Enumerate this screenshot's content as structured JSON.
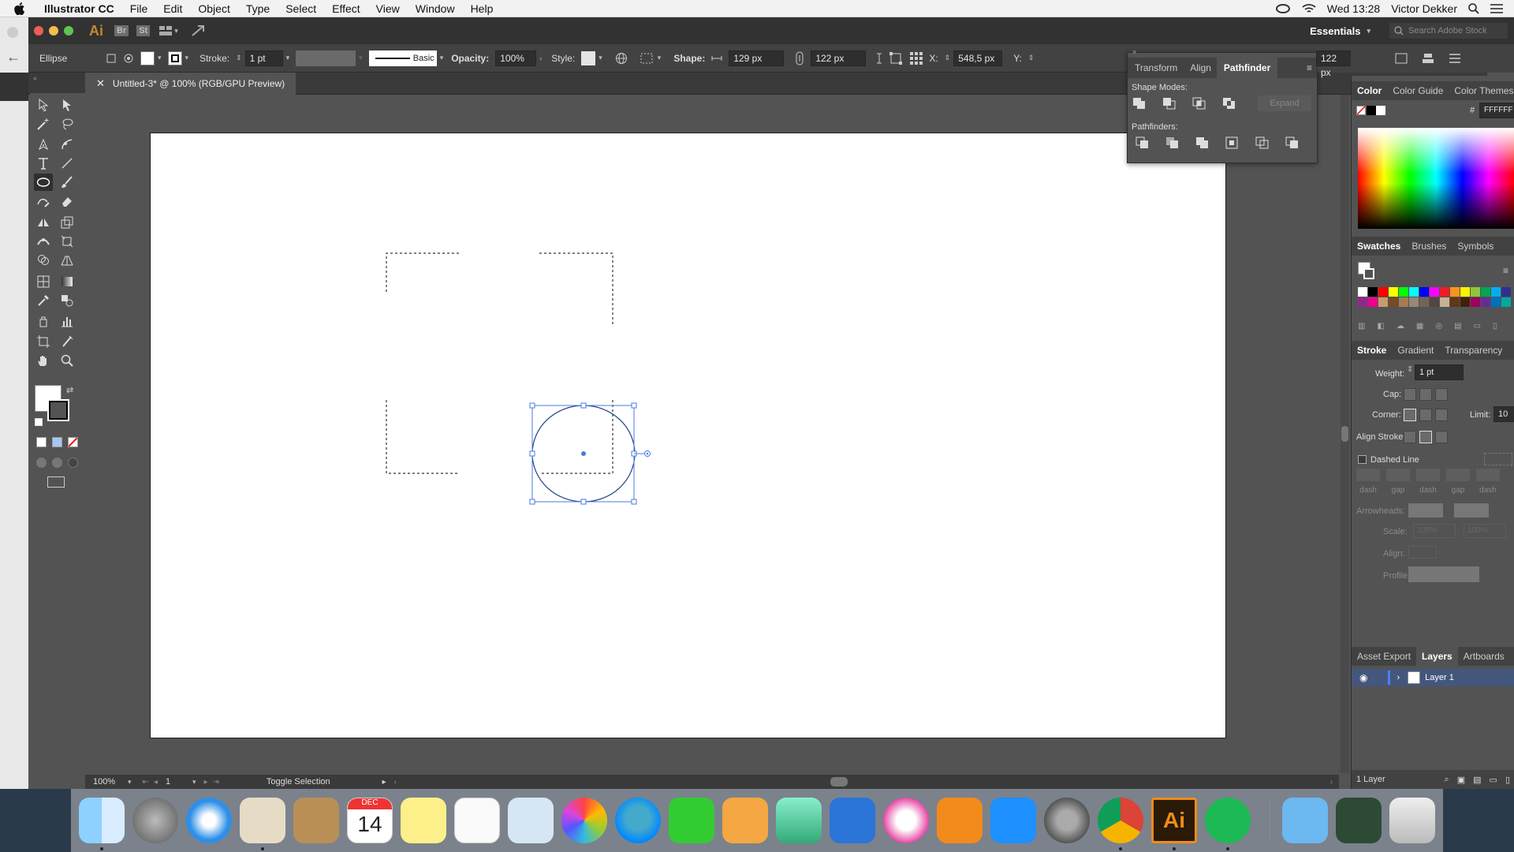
{
  "menubar": {
    "app_name": "Illustrator CC",
    "items": [
      "File",
      "Edit",
      "Object",
      "Type",
      "Select",
      "Effect",
      "View",
      "Window",
      "Help"
    ],
    "clock": "Wed 13:28",
    "user": "Victor Dekker"
  },
  "titlebar": {
    "app_logo": "Ai",
    "bridge": "Br",
    "stock": "St",
    "workspace": "Essentials",
    "search_placeholder": "Search Adobe Stock"
  },
  "control_bar": {
    "object_type": "Ellipse",
    "stroke_label": "Stroke:",
    "stroke_value": "1 pt",
    "brush_name": "Basic",
    "opacity_label": "Opacity:",
    "opacity_value": "100%",
    "style_label": "Style:",
    "shape_label": "Shape:",
    "shape_width": "129 px",
    "height_value": "122 px",
    "x_label": "X:",
    "x_value": "548,5 px",
    "y_label": "Y:",
    "h_value_right": "122 px"
  },
  "document": {
    "tab_title": "Untitled-3* @ 100% (RGB/GPU Preview)"
  },
  "status_bar": {
    "zoom": "100%",
    "artboard_num": "1",
    "status_text": "Toggle Selection"
  },
  "pathfinder_panel": {
    "tabs": [
      "Transform",
      "Align",
      "Pathfinder"
    ],
    "active_tab": "Pathfinder",
    "shape_modes_label": "Shape Modes:",
    "expand_label": "Expand",
    "pathfinders_label": "Pathfinders:"
  },
  "color_panel": {
    "tabs": [
      "Color",
      "Color Guide",
      "Color Themes"
    ],
    "hex_label": "#",
    "hex_value": "FFFFFF"
  },
  "swatches_panel": {
    "tabs": [
      "Swatches",
      "Brushes",
      "Symbols"
    ],
    "colors": [
      "#ffffff",
      "#000000",
      "#ff0000",
      "#ffff00",
      "#00ff00",
      "#00ffff",
      "#0000ff",
      "#ff00ff",
      "#ed1c24",
      "#f7941d",
      "#fff200",
      "#8dc63f",
      "#00a651",
      "#00aeef",
      "#2e3192",
      "#92278f",
      "#ec008c",
      "#c69c6d",
      "#754c24",
      "#a67c52",
      "#998675",
      "#736357",
      "#534741",
      "#c7b299",
      "#603813",
      "#42210b",
      "#9e005d",
      "#662d91",
      "#0072bc",
      "#00a99d"
    ]
  },
  "stroke_panel": {
    "tabs": [
      "Stroke",
      "Gradient",
      "Transparency"
    ],
    "weight_label": "Weight:",
    "weight_value": "1 pt",
    "cap_label": "Cap:",
    "corner_label": "Corner:",
    "limit_label": "Limit:",
    "limit_value": "10",
    "align_stroke_label": "Align Stroke:",
    "dashed_line_label": "Dashed Line",
    "dash_labels": [
      "dash",
      "gap",
      "dash",
      "gap",
      "dash"
    ],
    "arrowheads_label": "Arrowheads:",
    "scale_label": "Scale:",
    "scale_value": "100%",
    "align_label": "Align:",
    "profile_label": "Profile:"
  },
  "layers_panel": {
    "tabs": [
      "Asset Export",
      "Layers",
      "Artboards"
    ],
    "layer_name": "Layer 1",
    "footer_count": "1 Layer"
  },
  "calendar_icon": {
    "month": "DEC",
    "day": "14"
  },
  "dock_apps": [
    "finder-icon",
    "launchpad-icon",
    "safari-icon",
    "mail-icon",
    "contacts-icon",
    "calendar-icon",
    "notes-icon",
    "reminders-icon",
    "preview-icon",
    "photos-icon",
    "messages-icon",
    "facetime-icon",
    "pages-icon",
    "numbers-icon",
    "keynote-icon",
    "itunes-icon",
    "ibooks-icon",
    "app-store-icon",
    "system-preferences-icon",
    "chrome-icon",
    "illustrator-icon",
    "spotify-icon",
    "folder-icon",
    "archive-icon",
    "trash-icon"
  ],
  "colors": {
    "accent": "#2b6ed9",
    "selection": "#4a7be0",
    "panel_bg": "#535353"
  }
}
